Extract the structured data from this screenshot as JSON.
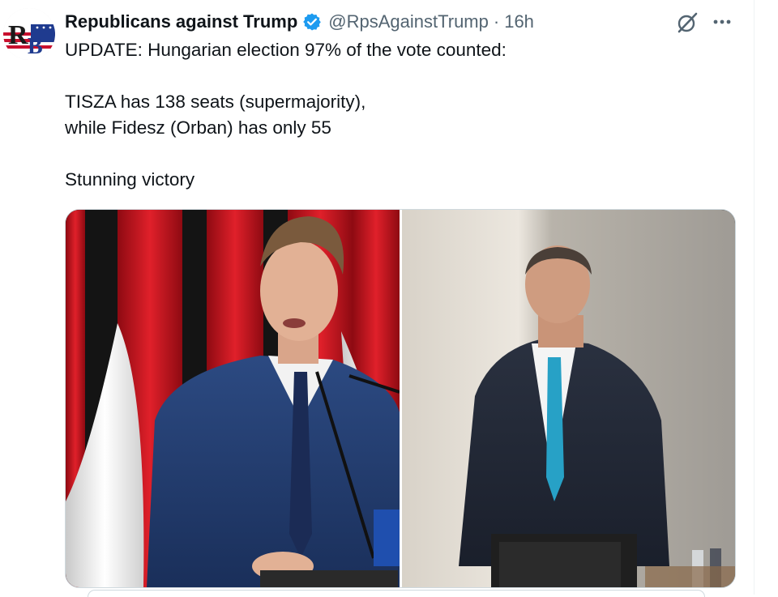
{
  "post": {
    "author_name": "Republicans against Trump",
    "handle": "@RpsAgainstTrump",
    "separator": "·",
    "time": "16h",
    "avatar_initials": "RB",
    "text_line1": "UPDATE: Hungarian election 97% of the vote counted:",
    "text_line2": "TISZA has 138 seats (supermajority),",
    "text_line3": "while Fidesz (Orban) has only 55",
    "text_line4": "Stunning victory"
  },
  "icons": {
    "verified": "verified-badge-icon",
    "grok": "grok-icon",
    "more": "more-options-icon"
  },
  "colors": {
    "verified_blue": "#1d9bf0",
    "secondary_text": "#536471",
    "primary_text": "#0f1419",
    "border": "#cfd9de"
  }
}
